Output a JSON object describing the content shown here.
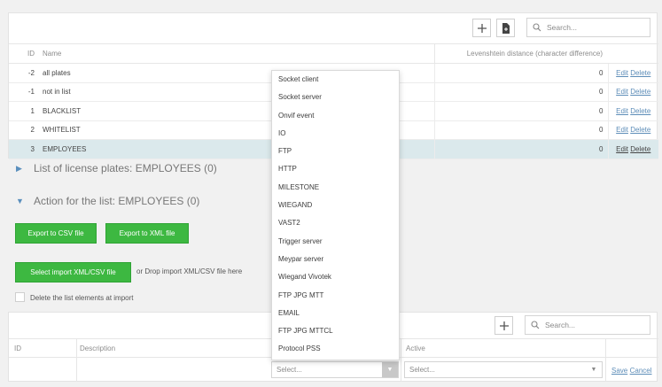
{
  "toolbar": {
    "add_icon": "plus-icon",
    "import_icon": "file-import-icon",
    "search_placeholder": "Search..."
  },
  "table": {
    "headers": {
      "id": "ID",
      "name": "Name",
      "distance": "Levenshtein distance (character difference)"
    },
    "rows": [
      {
        "id": "-2",
        "name": "all plates",
        "distance": "0",
        "edit": "Edit",
        "delete": "Delete"
      },
      {
        "id": "-1",
        "name": "not in list",
        "distance": "0",
        "edit": "Edit",
        "delete": "Delete"
      },
      {
        "id": "1",
        "name": "BLACKLIST",
        "distance": "0",
        "edit": "Edit",
        "delete": "Delete"
      },
      {
        "id": "2",
        "name": "WHITELIST",
        "distance": "0",
        "edit": "Edit",
        "delete": "Delete"
      },
      {
        "id": "3",
        "name": "EMPLOYEES",
        "distance": "0",
        "edit": "Edit",
        "delete": "Delete"
      }
    ]
  },
  "sections": {
    "plates": "List of license plates: EMPLOYEES (0)",
    "actions": "Action for the list: EMPLOYEES (0)"
  },
  "buttons": {
    "export_csv": "Export to CSV file",
    "export_xml": "Export to XML file",
    "import": "Select import XML/CSV file",
    "drop_text": "or Drop import XML/CSV file here",
    "delete_checkbox_label": "Delete the list elements at import"
  },
  "bottom": {
    "search_placeholder": "Search...",
    "headers": {
      "id": "ID",
      "description": "Description",
      "active": "Active"
    },
    "select_placeholder_1": "Select...",
    "select_placeholder_2": "Select...",
    "save": "Save",
    "cancel": "Cancel"
  },
  "dropdown": {
    "options": [
      "Socket client",
      "Socket server",
      "Onvif event",
      "IO",
      "FTP",
      "HTTP",
      "MILESTONE",
      "WIEGAND",
      "VAST2",
      "Trigger server",
      "Meypar server",
      "Wiegand Vivotek",
      "FTP JPG MTT",
      "EMAIL",
      "FTP JPG MTTCL",
      "Protocol PSS"
    ]
  },
  "colors": {
    "accent_green": "#3db841",
    "link_blue": "#5d8db8",
    "selected_row": "#dbe9ec"
  }
}
